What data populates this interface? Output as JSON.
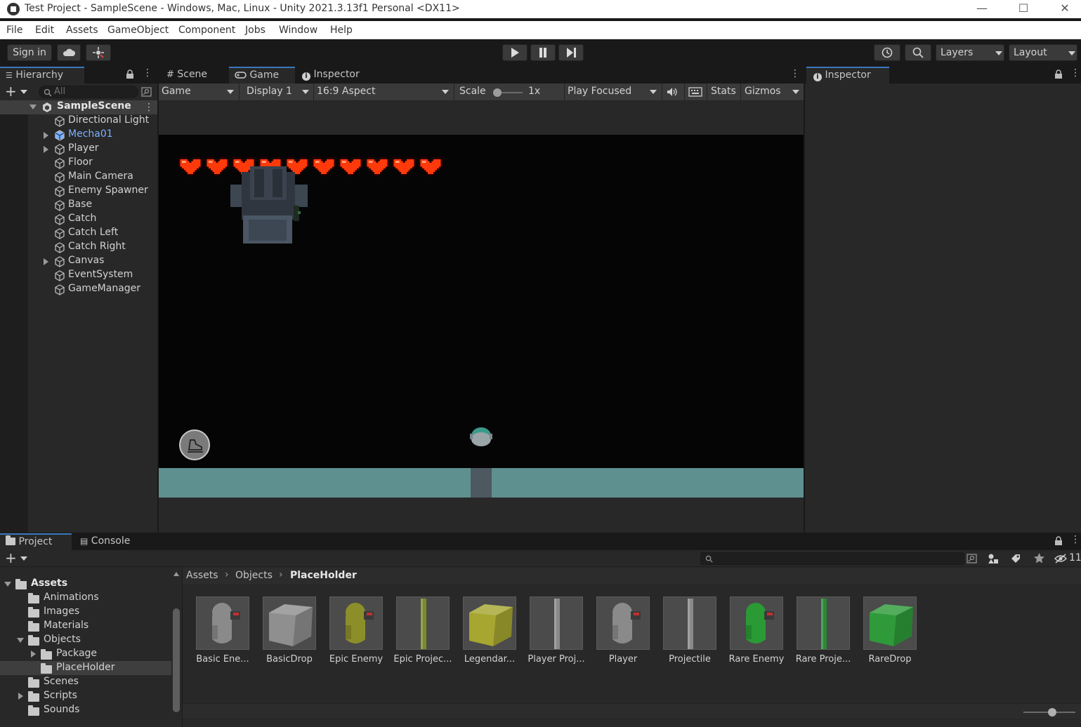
{
  "window": {
    "title": "Test Project - SampleScene - Windows, Mac, Linux - Unity 2021.3.13f1 Personal <DX11>",
    "controls": [
      "—",
      "☐",
      "✕"
    ]
  },
  "menu": [
    "File",
    "Edit",
    "Assets",
    "GameObject",
    "Component",
    "Jobs",
    "Window",
    "Help"
  ],
  "toolbar": {
    "sign_in": "Sign in",
    "layers": "Layers",
    "layout": "Layout"
  },
  "hierarchy": {
    "tab": "Hierarchy",
    "search_placeholder": "All",
    "scene": "SampleScene",
    "items": [
      {
        "label": "Directional Light",
        "expandable": false,
        "prefab": false
      },
      {
        "label": "Mecha01",
        "expandable": true,
        "prefab": true
      },
      {
        "label": "Player",
        "expandable": true,
        "prefab": false
      },
      {
        "label": "Floor",
        "expandable": false,
        "prefab": false
      },
      {
        "label": "Main Camera",
        "expandable": false,
        "prefab": false
      },
      {
        "label": "Enemy Spawner",
        "expandable": false,
        "prefab": false
      },
      {
        "label": "Base",
        "expandable": false,
        "prefab": false
      },
      {
        "label": "Catch",
        "expandable": false,
        "prefab": false
      },
      {
        "label": "Catch Left",
        "expandable": false,
        "prefab": false
      },
      {
        "label": "Catch Right",
        "expandable": false,
        "prefab": false
      },
      {
        "label": "Canvas",
        "expandable": true,
        "prefab": false
      },
      {
        "label": "EventSystem",
        "expandable": false,
        "prefab": false
      },
      {
        "label": "GameManager",
        "expandable": false,
        "prefab": false
      }
    ]
  },
  "center_tabs": {
    "scene": "Scene",
    "game": "Game",
    "inspector": "Inspector"
  },
  "game_toolbar": {
    "view": "Game",
    "display": "Display 1",
    "aspect": "16:9 Aspect",
    "scale_label": "Scale",
    "scale_value": "1x",
    "play_mode": "Play Focused",
    "stats": "Stats",
    "gizmos": "Gizmos",
    "scale_fraction": 0.0
  },
  "game_view": {
    "hearts": 10,
    "heart_color": "#ff3a0a",
    "floor_color": "#5f9090"
  },
  "inspector": {
    "tab": "Inspector"
  },
  "bottom_tabs": {
    "project": "Project",
    "console": "Console"
  },
  "project": {
    "hidden_count": "11",
    "breadcrumb": [
      "Assets",
      "Objects",
      "PlaceHolder"
    ],
    "tree": [
      {
        "label": "Assets",
        "depth": 0,
        "expanded": true,
        "arrow": "down",
        "bold": true
      },
      {
        "label": "Animations",
        "depth": 1,
        "arrow": "none"
      },
      {
        "label": "Images",
        "depth": 1,
        "arrow": "none"
      },
      {
        "label": "Materials",
        "depth": 1,
        "arrow": "none"
      },
      {
        "label": "Objects",
        "depth": 1,
        "arrow": "down"
      },
      {
        "label": "Package",
        "depth": 2,
        "arrow": "right"
      },
      {
        "label": "PlaceHolder",
        "depth": 2,
        "arrow": "none",
        "selected": true
      },
      {
        "label": "Scenes",
        "depth": 1,
        "arrow": "none"
      },
      {
        "label": "Scripts",
        "depth": 1,
        "arrow": "right"
      },
      {
        "label": "Sounds",
        "depth": 1,
        "arrow": "none"
      }
    ],
    "assets": [
      {
        "label": "Basic Ene...",
        "kind": "enemy",
        "color": "#8a8a8a"
      },
      {
        "label": "BasicDrop",
        "kind": "cube",
        "color": "#8f8f8f"
      },
      {
        "label": "Epic Enemy",
        "kind": "enemy",
        "color": "#8c8e2a"
      },
      {
        "label": "Epic Projec...",
        "kind": "bar",
        "color": "#7d8a2a"
      },
      {
        "label": "Legendar...",
        "kind": "cube",
        "color": "#a6a631"
      },
      {
        "label": "Player Proj...",
        "kind": "bar",
        "color": "#8a8a8a"
      },
      {
        "label": "Player",
        "kind": "enemy",
        "color": "#8a8a8a"
      },
      {
        "label": "Projectile",
        "kind": "bar",
        "color": "#8a8a8a"
      },
      {
        "label": "Rare Enemy",
        "kind": "enemy",
        "color": "#2a9a35"
      },
      {
        "label": "Rare Proje...",
        "kind": "bar",
        "color": "#2a8a35"
      },
      {
        "label": "RareDrop",
        "kind": "cube",
        "color": "#2f9a3a"
      }
    ]
  },
  "colors": {
    "accent": "#3a79bb",
    "prefab_text": "#7bb0ff",
    "selected_row": "#2c5d87"
  }
}
